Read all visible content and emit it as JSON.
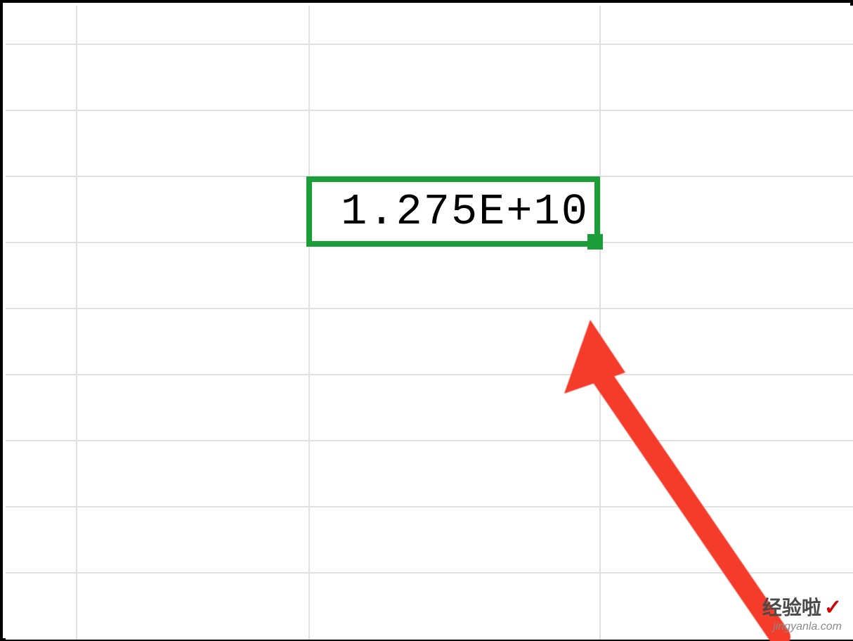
{
  "spreadsheet": {
    "selected_cell": {
      "value": "1.275E+10"
    }
  },
  "annotation": {
    "arrow_color": "#f53b2b"
  },
  "watermark": {
    "title": "经验啦",
    "check": "✓",
    "domain": "jingyanla.com"
  }
}
